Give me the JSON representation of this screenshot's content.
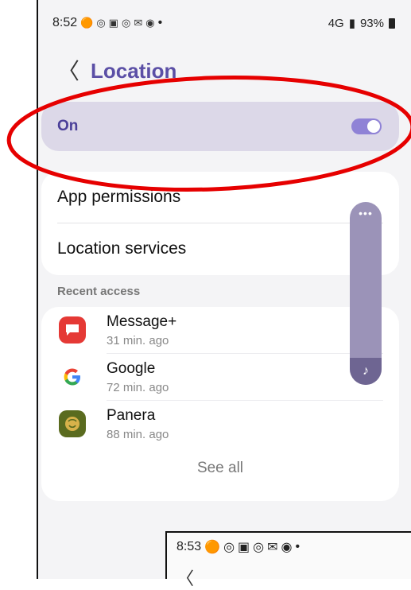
{
  "status_bar": {
    "time": "8:52",
    "network": "4G",
    "battery": "93%",
    "icons": [
      "app-icon",
      "circle-icon",
      "photo-icon",
      "circle-icon",
      "mail-icon",
      "chrome-icon"
    ],
    "dot": "•"
  },
  "header": {
    "back_glyph": "〈",
    "title": "Location"
  },
  "location_toggle": {
    "label": "On",
    "state": "on"
  },
  "menu": {
    "app_permissions": "App permissions",
    "location_services": "Location services"
  },
  "recent": {
    "label": "Recent access",
    "apps": [
      {
        "name": "Message+",
        "time": "31 min. ago",
        "icon_color": "#e53935",
        "icon": "chat-icon"
      },
      {
        "name": "Google",
        "time": "72 min. ago",
        "icon_color": "#ffffff",
        "icon": "google-icon"
      },
      {
        "name": "Panera",
        "time": "88 min. ago",
        "icon_color": "#5a6b1f",
        "icon": "panera-icon"
      }
    ],
    "see_all": "See all"
  },
  "edge_panel": {
    "dots": "•••",
    "music_glyph": "♪"
  },
  "overlay_screen": {
    "time": "8:53",
    "dot": "•",
    "back_glyph": "〈"
  },
  "colors": {
    "accent": "#5b4fa6",
    "toggle": "#8f82d6",
    "annotation": "#e60000"
  }
}
